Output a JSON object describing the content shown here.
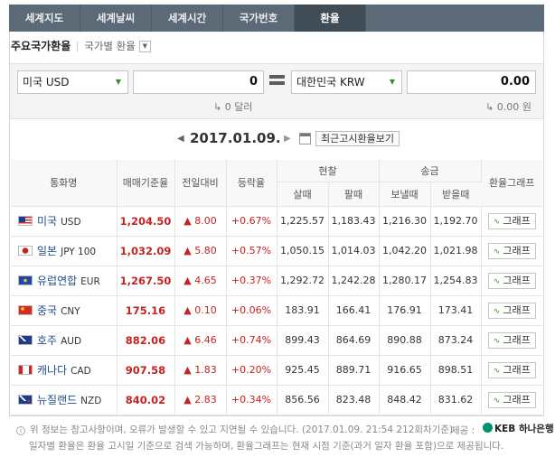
{
  "tabs": [
    "세계지도",
    "세계날씨",
    "세계시간",
    "국가번호",
    "환율"
  ],
  "header": {
    "title": "주요국가환율",
    "subtitle": "국가별 환율"
  },
  "converter": {
    "from": {
      "currency": "미국 USD",
      "amount": "0",
      "hint": "0 달러"
    },
    "to": {
      "currency": "대한민국 KRW",
      "amount": "0.00",
      "hint": "0.00 원"
    }
  },
  "date": {
    "value": "2017.01.09.",
    "notice_button": "최근고시환율보기"
  },
  "table": {
    "headers": {
      "currency": "통화명",
      "base": "매매기준율",
      "change": "전일대비",
      "rate": "등락율",
      "cash": "현찰",
      "cash_buy": "살때",
      "cash_sell": "팔때",
      "transfer": "송금",
      "send": "보낼때",
      "receive": "받을때",
      "graph": "환율그래프"
    },
    "graph_label": "그래프",
    "rows": [
      {
        "name": "미국",
        "code": "USD",
        "base": "1,204.50",
        "change": "▲ 8.00",
        "rate": "+0.67%",
        "cash_buy": "1,225.57",
        "cash_sell": "1,183.43",
        "send": "1,216.30",
        "receive": "1,192.70",
        "flag": "us-flag"
      },
      {
        "name": "일본",
        "code": "JPY 100",
        "base": "1,032.09",
        "change": "▲ 5.80",
        "rate": "+0.57%",
        "cash_buy": "1,050.15",
        "cash_sell": "1,014.03",
        "send": "1,042.20",
        "receive": "1,021.98",
        "flag": "japan-flag"
      },
      {
        "name": "유럽연합",
        "code": "EUR",
        "base": "1,267.50",
        "change": "▲ 4.65",
        "rate": "+0.37%",
        "cash_buy": "1,292.72",
        "cash_sell": "1,242.28",
        "send": "1,280.17",
        "receive": "1,254.83",
        "flag": "eu-flag"
      },
      {
        "name": "중국",
        "code": "CNY",
        "base": "175.16",
        "change": "▲ 0.10",
        "rate": "+0.06%",
        "cash_buy": "183.91",
        "cash_sell": "166.41",
        "send": "176.91",
        "receive": "173.41",
        "flag": "china-flag"
      },
      {
        "name": "호주",
        "code": "AUD",
        "base": "882.06",
        "change": "▲ 6.46",
        "rate": "+0.74%",
        "cash_buy": "899.43",
        "cash_sell": "864.69",
        "send": "890.88",
        "receive": "873.24",
        "flag": "australia-flag"
      },
      {
        "name": "캐나다",
        "code": "CAD",
        "base": "907.58",
        "change": "▲ 1.83",
        "rate": "+0.20%",
        "cash_buy": "925.45",
        "cash_sell": "889.71",
        "send": "916.65",
        "receive": "898.51",
        "flag": "canada-flag"
      },
      {
        "name": "뉴질랜드",
        "code": "NZD",
        "base": "840.02",
        "change": "▲ 2.83",
        "rate": "+0.34%",
        "cash_buy": "856.56",
        "cash_sell": "823.48",
        "send": "848.42",
        "receive": "831.62",
        "flag": "newzealand-flag"
      }
    ]
  },
  "footer": {
    "note1": "위 정보는 참고사항이며, 오류가 발생할 수 있고 지연될 수 있습니다. (2017.01.09. 21:54 212회차기준)",
    "note2": "일자별 환율은 환율 고시일 기준으로 검색 가능하며, 환율그래프는 현재 시점 기준(과거 일자 환율 포함)으로 제공됩니다.",
    "source_label": "제공 :",
    "provider": "KEB 하나은행"
  },
  "colors": {
    "tab_bg": "#5b6a76",
    "tab_active": "#3f4c56",
    "up": "#c52323",
    "link": "#1f4e8a"
  }
}
